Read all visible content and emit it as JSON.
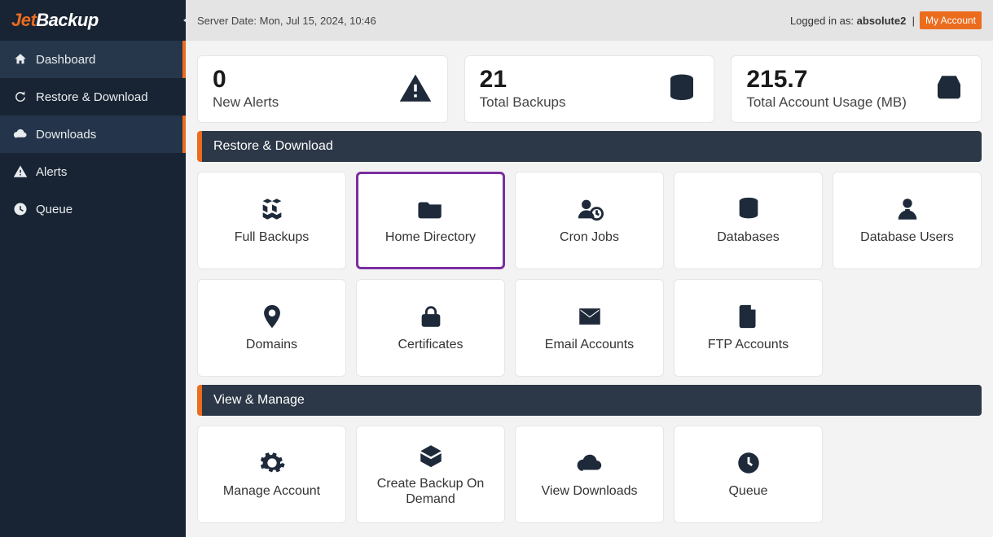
{
  "brand": {
    "part1": "Jet",
    "part2": "Backup"
  },
  "sidebar": {
    "items": [
      {
        "label": "Dashboard",
        "icon": "home",
        "state": "active"
      },
      {
        "label": "Restore & Download",
        "icon": "refresh",
        "state": ""
      },
      {
        "label": "Downloads",
        "icon": "cloud-dl",
        "state": "sel"
      },
      {
        "label": "Alerts",
        "icon": "alert",
        "state": ""
      },
      {
        "label": "Queue",
        "icon": "clock",
        "state": ""
      }
    ]
  },
  "topbar": {
    "server_date_label": "Server Date:",
    "server_date": "Mon, Jul 15, 2024, 10:46",
    "logged_in_prefix": "Logged in as:",
    "user": "absolute2",
    "my_account_label": "My Account"
  },
  "stats": [
    {
      "value": "0",
      "label": "New Alerts",
      "icon": "alert-big"
    },
    {
      "value": "21",
      "label": "Total Backups",
      "icon": "db"
    },
    {
      "value": "215.7",
      "label": "Total Account Usage (MB)",
      "icon": "hdd"
    }
  ],
  "sections": [
    {
      "title": "Restore & Download",
      "tiles": [
        {
          "label": "Full Backups",
          "icon": "boxes",
          "highlight": false
        },
        {
          "label": "Home Directory",
          "icon": "folder",
          "highlight": true
        },
        {
          "label": "Cron Jobs",
          "icon": "usercron",
          "highlight": false
        },
        {
          "label": "Databases",
          "icon": "db",
          "highlight": false
        },
        {
          "label": "Database Users",
          "icon": "dbuser",
          "highlight": false
        },
        {
          "label": "Domains",
          "icon": "pin",
          "highlight": false
        },
        {
          "label": "Certificates",
          "icon": "lock",
          "highlight": false
        },
        {
          "label": "Email Accounts",
          "icon": "mail",
          "highlight": false
        },
        {
          "label": "FTP Accounts",
          "icon": "file",
          "highlight": false
        }
      ]
    },
    {
      "title": "View & Manage",
      "tiles": [
        {
          "label": "Manage Account",
          "icon": "gear",
          "highlight": false
        },
        {
          "label": "Create Backup On Demand",
          "icon": "box",
          "highlight": false
        },
        {
          "label": "View Downloads",
          "icon": "clouddl",
          "highlight": false
        },
        {
          "label": "Queue",
          "icon": "clock2",
          "highlight": false
        }
      ]
    }
  ]
}
